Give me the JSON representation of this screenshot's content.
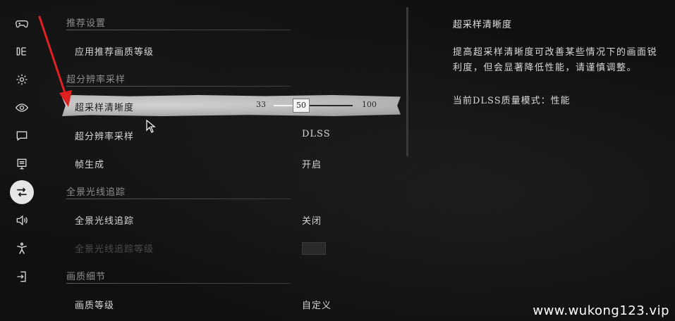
{
  "sidebar": {
    "items": [
      {
        "icon": "gamepad-icon",
        "active": false
      },
      {
        "icon": "display-icon",
        "active": false
      },
      {
        "icon": "gear-icon",
        "active": false
      },
      {
        "icon": "eye-icon",
        "active": false
      },
      {
        "icon": "chat-icon",
        "active": false
      },
      {
        "icon": "monitor-icon",
        "active": false
      },
      {
        "icon": "adjust-icon",
        "active": true
      },
      {
        "icon": "speaker-icon",
        "active": false
      },
      {
        "icon": "accessibility-icon",
        "active": false
      },
      {
        "icon": "exit-icon",
        "active": false
      }
    ]
  },
  "sections": {
    "recommended": "推荐设置",
    "super_resolution": "超分辨率采样",
    "path_tracing": "全景光线追踪",
    "quality_detail": "画质细节"
  },
  "rows": {
    "apply_recommended": {
      "label": "应用推荐画质等级"
    },
    "sharpness": {
      "label": "超采样清晰度",
      "min": "33",
      "max": "100",
      "value": "50",
      "fraction": 0.25
    },
    "upscaling": {
      "label": "超分辨率采样",
      "value": "DLSS"
    },
    "frame_gen": {
      "label": "帧生成",
      "value": "开启"
    },
    "path_tracing": {
      "label": "全景光线追踪",
      "value": "关闭"
    },
    "path_tracing_level": {
      "label": "全景光线追踪等级",
      "disabled": true
    },
    "quality_level": {
      "label": "画质等级",
      "value": "自定义"
    }
  },
  "description": {
    "title": "超采样清晰度",
    "body": "提高超采样清晰度可改善某些情况下的画面锐利度，但会显著降低性能，请谨慎调整。",
    "mode": "当前DLSS质量模式：性能"
  },
  "watermark": "www.wukong123.vip",
  "colors": {
    "background": "#101010",
    "selected_row": "#c4c4c4",
    "annotation_arrow": "#e02020"
  }
}
